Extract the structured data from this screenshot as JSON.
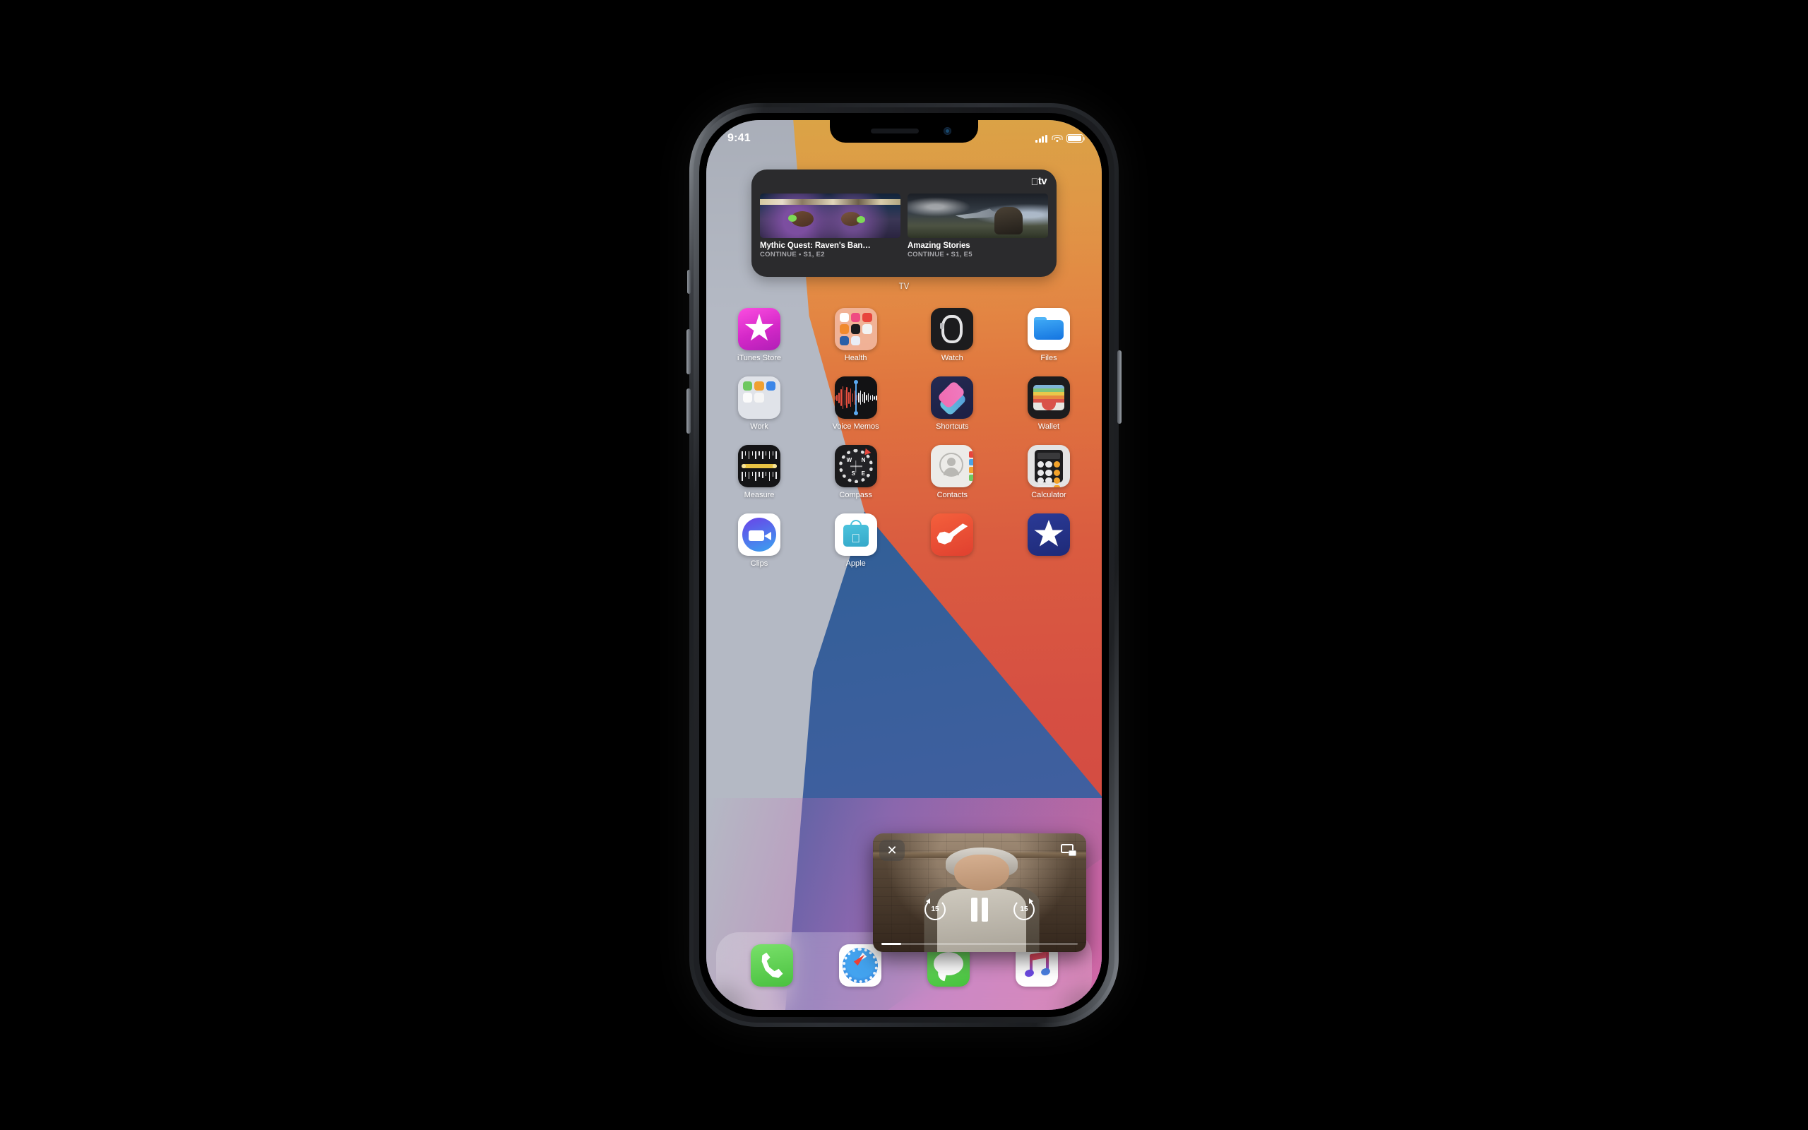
{
  "status_bar": {
    "time": "9:41",
    "signal_icon": "cellular-bars-icon",
    "wifi_icon": "wifi-icon",
    "battery_icon": "battery-full-icon"
  },
  "tv_widget": {
    "brand_apple": "",
    "brand_tv": "tv",
    "label": "TV",
    "cards": [
      {
        "title": "Mythic Quest: Raven's Ban…",
        "subtitle": "CONTINUE • S1, E2"
      },
      {
        "title": "Amazing Stories",
        "subtitle": "CONTINUE • S1, E5"
      }
    ]
  },
  "home_grid": {
    "rows": [
      [
        {
          "label": "iTunes Store",
          "icon": "itunes-store-icon"
        },
        {
          "label": "Health",
          "icon": "health-folder-icon"
        },
        {
          "label": "Watch",
          "icon": "watch-icon"
        },
        {
          "label": "Files",
          "icon": "files-icon"
        }
      ],
      [
        {
          "label": "Work",
          "icon": "work-folder-icon"
        },
        {
          "label": "Voice Memos",
          "icon": "voice-memos-icon"
        },
        {
          "label": "Shortcuts",
          "icon": "shortcuts-icon"
        },
        {
          "label": "Wallet",
          "icon": "wallet-icon"
        }
      ],
      [
        {
          "label": "Measure",
          "icon": "measure-icon"
        },
        {
          "label": "Compass",
          "icon": "compass-icon"
        },
        {
          "label": "Contacts",
          "icon": "contacts-icon"
        },
        {
          "label": "Calculator",
          "icon": "calculator-icon"
        }
      ],
      [
        {
          "label": "Clips",
          "icon": "clips-icon"
        },
        {
          "label": "Apple",
          "icon": "apple-store-icon"
        },
        {
          "label": "",
          "icon": "garageband-icon"
        },
        {
          "label": "",
          "icon": "apple-support-star-icon"
        }
      ]
    ]
  },
  "compass_icon": {
    "n": "N",
    "e": "E",
    "s": "S",
    "w": "W"
  },
  "pip_player": {
    "close_label": "✕",
    "close_icon": "close-icon",
    "expand_icon": "picture-in-picture-expand-icon",
    "skip_back_label": "15",
    "skip_back_icon": "skip-back-15-icon",
    "skip_forward_label": "15",
    "skip_forward_icon": "skip-forward-15-icon",
    "play_state": "pause",
    "pause_icon": "pause-icon",
    "progress_percent": 10
  },
  "dock": {
    "items": [
      {
        "label": "Phone",
        "icon": "phone-icon"
      },
      {
        "label": "Safari",
        "icon": "safari-icon"
      },
      {
        "label": "Messages",
        "icon": "messages-icon"
      },
      {
        "label": "Music",
        "icon": "music-icon"
      }
    ]
  },
  "device": {
    "mute_switch": "mute-switch",
    "volume_up": "volume-up-button",
    "volume_down": "volume-down-button",
    "side_button": "side-power-button"
  },
  "colors": {
    "background": "#000000",
    "widget_bg": "#2b2b2d",
    "wallpaper_orange": "#e0763f",
    "wallpaper_red": "#d64f42",
    "wallpaper_blue": "#2f5f96",
    "wallpaper_purple": "#7d5bbd",
    "wallpaper_grey": "#b4b9c4",
    "wallpaper_pink": "#de69a0"
  }
}
